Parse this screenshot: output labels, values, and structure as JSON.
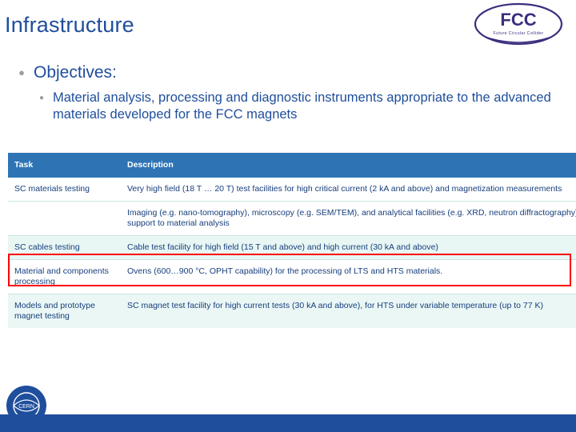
{
  "slide": {
    "title": "Infrastructure",
    "bullets": {
      "level1": "Objectives:",
      "level2": "Material analysis, processing and diagnostic instruments appropriate to the advanced materials developed for the FCC magnets"
    },
    "logo": {
      "name": "fcc-logo",
      "text": "FCC",
      "subtext": "Future Circular Collider"
    },
    "footer_logo": {
      "name": "cern-logo",
      "text": "CERN"
    },
    "table": {
      "headers": [
        "Task",
        "Description"
      ],
      "rows": [
        {
          "task": "SC materials testing",
          "description": "Very high field (18 T … 20 T) test facilities for high critical current (2 kA and above) and magnetization measurements",
          "highlighted": false
        },
        {
          "task": "",
          "description": "Imaging (e.g. nano-tomography), microscopy (e.g. SEM/TEM), and analytical facilities (e.g. XRD, neutron diffractography) in support to material analysis",
          "highlighted": false
        },
        {
          "task": "SC cables testing",
          "description": "Cable test facility for high field (15 T and above) and high current (30 kA and above)",
          "highlighted": true
        },
        {
          "task": "Material and components processing",
          "description": "Ovens (600…900 °C, OPHT capability) for the processing of LTS and HTS materials.",
          "highlighted": false
        },
        {
          "task": "Models and prototype magnet testing",
          "description": "SC magnet test facility for high current tests (30 kA and above), for HTS under variable temperature (up to 77 K)",
          "highlighted": false
        }
      ]
    },
    "colors": {
      "title": "#1F4E9C",
      "header_bg": "#2E74B5",
      "highlight": "#FF0000",
      "band": "#E8F7F4",
      "footer_bar": "#1F4E9C"
    }
  }
}
